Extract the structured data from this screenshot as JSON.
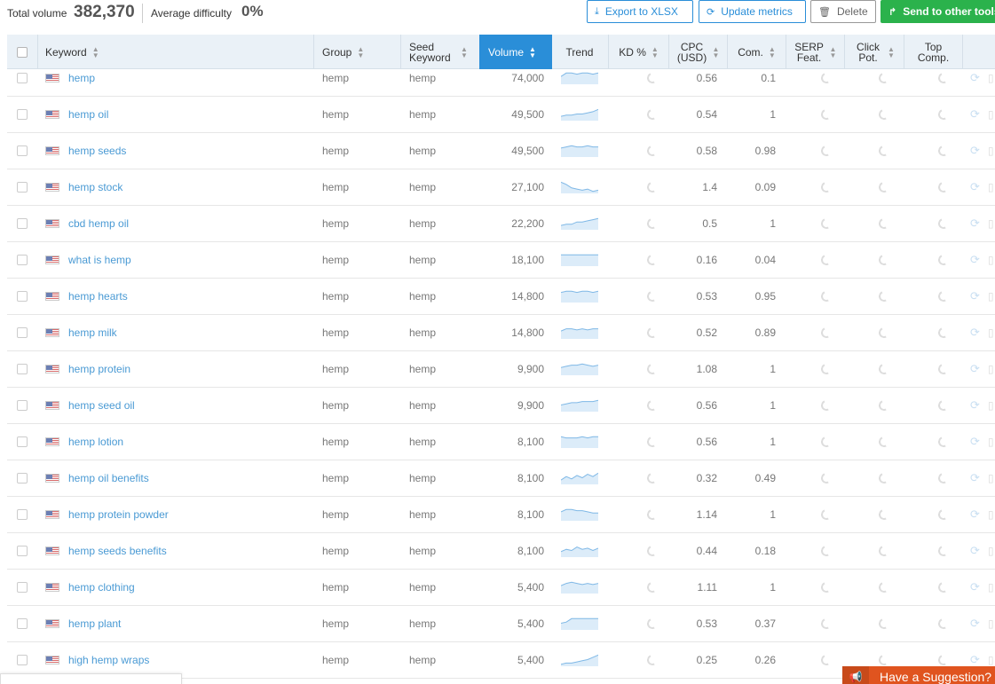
{
  "summary": {
    "total_volume_label": "Total volume",
    "total_volume_value": "382,370",
    "avg_difficulty_label": "Average difficulty",
    "avg_difficulty_value": "0%"
  },
  "toolbar": {
    "export_label": "Export to XLSX",
    "update_label": "Update metrics",
    "delete_label": "Delete",
    "send_label": "Send to other tools"
  },
  "columns": {
    "keyword": "Keyword",
    "group": "Group",
    "seed_keyword": "Seed Keyword",
    "volume": "Volume",
    "trend": "Trend",
    "kd": "KD %",
    "cpc": "CPC (USD)",
    "com": "Com.",
    "serp": "SERP Feat.",
    "click": "Click Pot.",
    "top": "Top Comp."
  },
  "rows": [
    {
      "keyword": "hemp",
      "group": "hemp",
      "seed": "hemp",
      "volume": "74,000",
      "cpc": "0.56",
      "com": "0.1",
      "trend": [
        6,
        9,
        9,
        8,
        9,
        9,
        8,
        9
      ]
    },
    {
      "keyword": "hemp oil",
      "group": "hemp",
      "seed": "hemp",
      "volume": "49,500",
      "cpc": "0.54",
      "com": "1",
      "trend": [
        3,
        4,
        4,
        5,
        5,
        6,
        7,
        9
      ]
    },
    {
      "keyword": "hemp seeds",
      "group": "hemp",
      "seed": "hemp",
      "volume": "49,500",
      "cpc": "0.58",
      "com": "0.98",
      "trend": [
        7,
        8,
        9,
        8,
        8,
        9,
        8,
        8
      ]
    },
    {
      "keyword": "hemp stock",
      "group": "hemp",
      "seed": "hemp",
      "volume": "27,100",
      "cpc": "1.4",
      "com": "0.09",
      "trend": [
        9,
        7,
        4,
        3,
        2,
        3,
        1,
        2
      ]
    },
    {
      "keyword": "cbd hemp oil",
      "group": "hemp",
      "seed": "hemp",
      "volume": "22,200",
      "cpc": "0.5",
      "com": "1",
      "trend": [
        3,
        4,
        4,
        6,
        6,
        7,
        8,
        9
      ]
    },
    {
      "keyword": "what is hemp",
      "group": "hemp",
      "seed": "hemp",
      "volume": "18,100",
      "cpc": "0.16",
      "com": "0.04",
      "trend": [
        9,
        9,
        9,
        9,
        9,
        9,
        9,
        9
      ]
    },
    {
      "keyword": "hemp hearts",
      "group": "hemp",
      "seed": "hemp",
      "volume": "14,800",
      "cpc": "0.53",
      "com": "0.95",
      "trend": [
        8,
        9,
        9,
        8,
        9,
        9,
        8,
        9
      ]
    },
    {
      "keyword": "hemp milk",
      "group": "hemp",
      "seed": "hemp",
      "volume": "14,800",
      "cpc": "0.52",
      "com": "0.89",
      "trend": [
        6,
        8,
        8,
        7,
        8,
        7,
        8,
        8
      ]
    },
    {
      "keyword": "hemp protein",
      "group": "hemp",
      "seed": "hemp",
      "volume": "9,900",
      "cpc": "1.08",
      "com": "1",
      "trend": [
        6,
        7,
        8,
        8,
        9,
        8,
        7,
        8
      ]
    },
    {
      "keyword": "hemp seed oil",
      "group": "hemp",
      "seed": "hemp",
      "volume": "9,900",
      "cpc": "0.56",
      "com": "1",
      "trend": [
        5,
        6,
        7,
        7,
        8,
        8,
        8,
        9
      ]
    },
    {
      "keyword": "hemp lotion",
      "group": "hemp",
      "seed": "hemp",
      "volume": "8,100",
      "cpc": "0.56",
      "com": "1",
      "trend": [
        9,
        8,
        8,
        8,
        9,
        8,
        9,
        9
      ]
    },
    {
      "keyword": "hemp oil benefits",
      "group": "hemp",
      "seed": "hemp",
      "volume": "8,100",
      "cpc": "0.32",
      "com": "0.49",
      "trend": [
        3,
        6,
        4,
        7,
        5,
        8,
        6,
        9
      ]
    },
    {
      "keyword": "hemp protein powder",
      "group": "hemp",
      "seed": "hemp",
      "volume": "8,100",
      "cpc": "1.14",
      "com": "1",
      "trend": [
        7,
        9,
        9,
        8,
        8,
        7,
        6,
        6
      ]
    },
    {
      "keyword": "hemp seeds benefits",
      "group": "hemp",
      "seed": "hemp",
      "volume": "8,100",
      "cpc": "0.44",
      "com": "0.18",
      "trend": [
        4,
        6,
        5,
        8,
        6,
        7,
        5,
        7
      ]
    },
    {
      "keyword": "hemp clothing",
      "group": "hemp",
      "seed": "hemp",
      "volume": "5,400",
      "cpc": "1.11",
      "com": "1",
      "trend": [
        6,
        8,
        9,
        8,
        7,
        8,
        7,
        8
      ]
    },
    {
      "keyword": "hemp plant",
      "group": "hemp",
      "seed": "hemp",
      "volume": "5,400",
      "cpc": "0.53",
      "com": "0.37",
      "trend": [
        5,
        6,
        9,
        9,
        9,
        9,
        9,
        9
      ]
    },
    {
      "keyword": "high hemp wraps",
      "group": "hemp",
      "seed": "hemp",
      "volume": "5,400",
      "cpc": "0.25",
      "com": "0.26",
      "trend": [
        1,
        2,
        2,
        3,
        4,
        5,
        7,
        9
      ]
    }
  ],
  "suggestion": {
    "label": "Have a Suggestion?"
  },
  "colors": {
    "accent": "#2a8ed8",
    "send": "#2bb24c",
    "suggest": "#e0541f",
    "keyword": "#4a9ad4"
  }
}
